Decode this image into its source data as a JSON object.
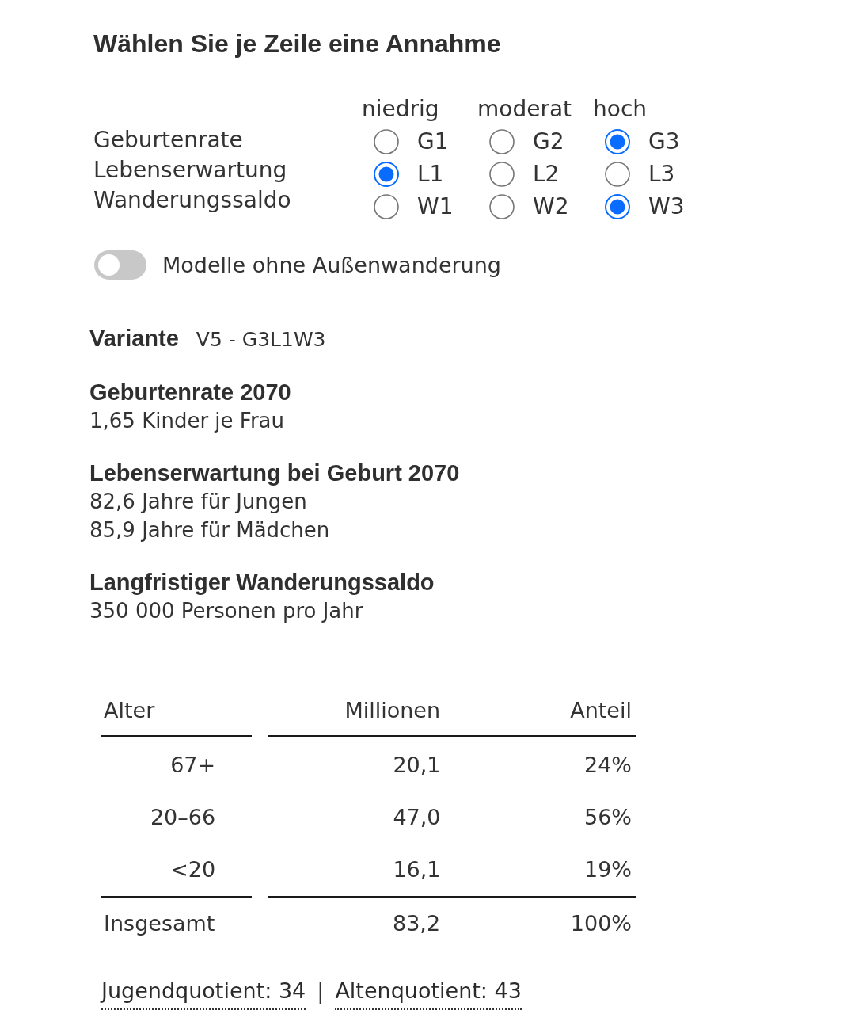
{
  "heading": "Wählen Sie je Zeile eine Annahme",
  "choice_grid": {
    "columns": [
      "niedrig",
      "moderat",
      "hoch"
    ],
    "rows": [
      {
        "label": "Geburtenrate",
        "options": [
          {
            "label": "G1",
            "selected": false
          },
          {
            "label": "G2",
            "selected": false
          },
          {
            "label": "G3",
            "selected": true
          }
        ]
      },
      {
        "label": "Lebenserwartung",
        "options": [
          {
            "label": "L1",
            "selected": true
          },
          {
            "label": "L2",
            "selected": false
          },
          {
            "label": "L3",
            "selected": false
          }
        ]
      },
      {
        "label": "Wanderungssaldo",
        "options": [
          {
            "label": "W1",
            "selected": false
          },
          {
            "label": "W2",
            "selected": false
          },
          {
            "label": "W3",
            "selected": true
          }
        ]
      }
    ]
  },
  "toggle": {
    "label": "Modelle ohne Außenwanderung",
    "on": false
  },
  "variant": {
    "label": "Variante",
    "value": "V5 - G3L1W3"
  },
  "facts": [
    {
      "title": "Geburtenrate 2070",
      "lines": [
        "1,65 Kinder je Frau"
      ]
    },
    {
      "title": "Lebenserwartung bei Geburt 2070",
      "lines": [
        "82,6 Jahre für Jungen",
        "85,9 Jahre für Mädchen"
      ]
    },
    {
      "title": "Langfristiger Wanderungssaldo",
      "lines": [
        "350 000 Personen pro Jahr"
      ]
    }
  ],
  "table": {
    "columns": [
      "Alter",
      "Millionen",
      "Anteil"
    ],
    "rows": [
      [
        "67+",
        "20,1",
        "24%"
      ],
      [
        "20–66",
        "47,0",
        "56%"
      ],
      [
        "<20",
        "16,1",
        "19%"
      ]
    ],
    "total": [
      "Insgesamt",
      "83,2",
      "100%"
    ]
  },
  "ratios": [
    {
      "label": "Jugendquotient: 34"
    },
    {
      "label": "Altenquotient: 43"
    }
  ],
  "ratio_separator": "|"
}
